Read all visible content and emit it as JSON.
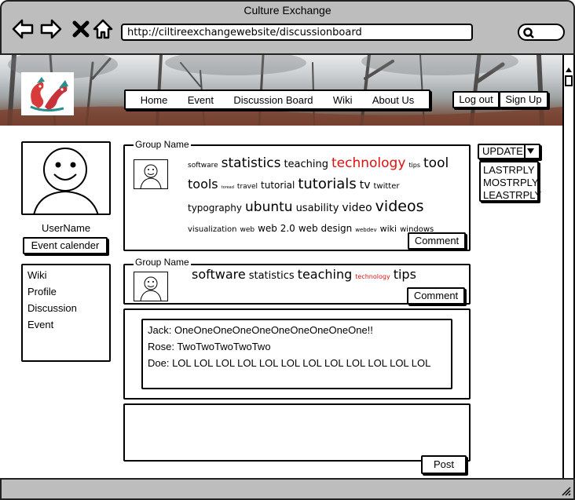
{
  "window": {
    "title": "Culture Exchange"
  },
  "browser": {
    "url": "http://ciltireexchangewebsite/discussionboard"
  },
  "nav": {
    "items": [
      "Home",
      "Event",
      "Discussion Board",
      "Wiki",
      "About Us"
    ]
  },
  "auth": {
    "logout": "Log out",
    "signup": "Sign Up"
  },
  "profile": {
    "username": "UserName",
    "event_button": "Event calender"
  },
  "side_menu": {
    "items": [
      "Wiki",
      "Profile",
      "Discussion",
      "Event"
    ]
  },
  "groups": [
    {
      "legend": "Group Name",
      "tags": [
        {
          "text": "software",
          "size": 9
        },
        {
          "text": "statistics",
          "size": 17
        },
        {
          "text": "teaching",
          "size": 13
        },
        {
          "text": "technology",
          "size": 17,
          "color": "#e01010"
        },
        {
          "text": "tips",
          "size": 8
        },
        {
          "text": "tool",
          "size": 17
        },
        {
          "text": "tools",
          "size": 16
        },
        {
          "text": "toread",
          "size": 5
        },
        {
          "text": "travel",
          "size": 9
        },
        {
          "text": "tutorial",
          "size": 12
        },
        {
          "text": "tutorials",
          "size": 18
        },
        {
          "text": "tv",
          "size": 14
        },
        {
          "text": "twitter",
          "size": 10
        },
        {
          "text": "typography",
          "size": 12
        },
        {
          "text": "ubuntu",
          "size": 17
        },
        {
          "text": "usability",
          "size": 13
        },
        {
          "text": "video",
          "size": 14
        },
        {
          "text": "videos",
          "size": 19
        },
        {
          "text": "visualization",
          "size": 10
        },
        {
          "text": "web",
          "size": 9
        },
        {
          "text": "web 2.0",
          "size": 12
        },
        {
          "text": "web design",
          "size": 12
        },
        {
          "text": "webdev",
          "size": 7
        },
        {
          "text": "wiki",
          "size": 11
        },
        {
          "text": "windows",
          "size": 10
        }
      ],
      "comment_label": "Comment"
    },
    {
      "legend": "Group Name",
      "tags": [
        {
          "text": "software",
          "size": 16
        },
        {
          "text": "statistics",
          "size": 13
        },
        {
          "text": "teaching",
          "size": 16
        },
        {
          "text": "technology",
          "size": 8,
          "color": "#e01010"
        },
        {
          "text": "tips",
          "size": 16
        }
      ],
      "comment_label": "Comment"
    }
  ],
  "discussion": {
    "messages": [
      "Jack: OneOneOneOneOneOneOneOneOneOne!!",
      "Rose: TwoTwoTwoTwoTwo",
      "Doe: LOL LOL LOL LOL LOL LOL LOL LOL LOL LOL LOL LOL"
    ]
  },
  "post": {
    "label": "Post"
  },
  "sort": {
    "button": "UPDATE",
    "options": [
      "LASTRPLY",
      "MOSTRPLY",
      "LEASTRPLY"
    ]
  }
}
